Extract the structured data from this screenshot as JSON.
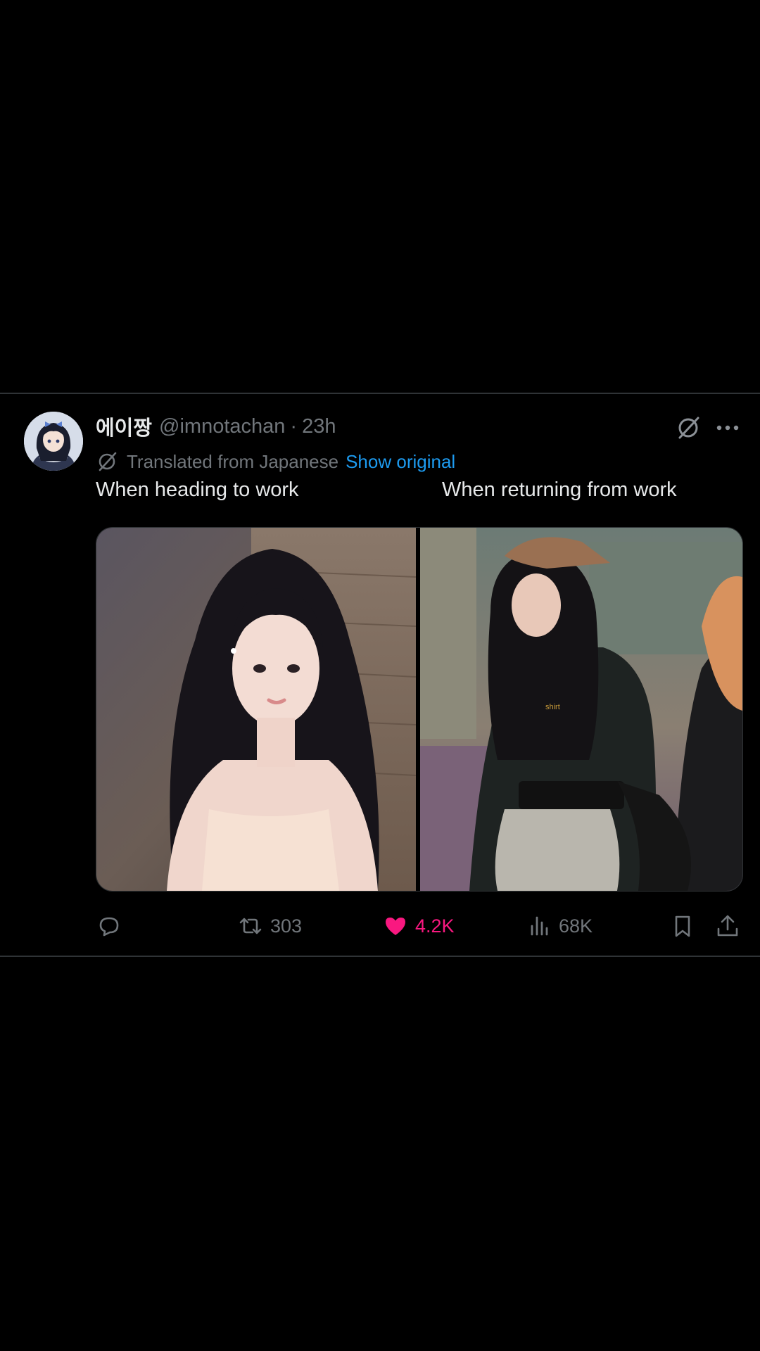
{
  "tweet": {
    "author": {
      "display_name": "에이짱",
      "handle": "@imnotachan",
      "separator": "·",
      "time": "23h"
    },
    "translation": {
      "label": "Translated from Japanese",
      "show_original": "Show original"
    },
    "captions": {
      "left": "When heading to work",
      "right": "When returning from work"
    },
    "media_text": "shirt",
    "actions": {
      "replies": "",
      "retweets": "303",
      "likes": "4.2K",
      "views": "68K"
    },
    "like_color": "#f91880",
    "link_color": "#1d9bf0"
  },
  "icons": [
    "grok-icon",
    "more-icon",
    "translate-icon",
    "reply-icon",
    "retweet-icon",
    "heart-icon",
    "views-icon",
    "bookmark-icon",
    "share-icon"
  ]
}
